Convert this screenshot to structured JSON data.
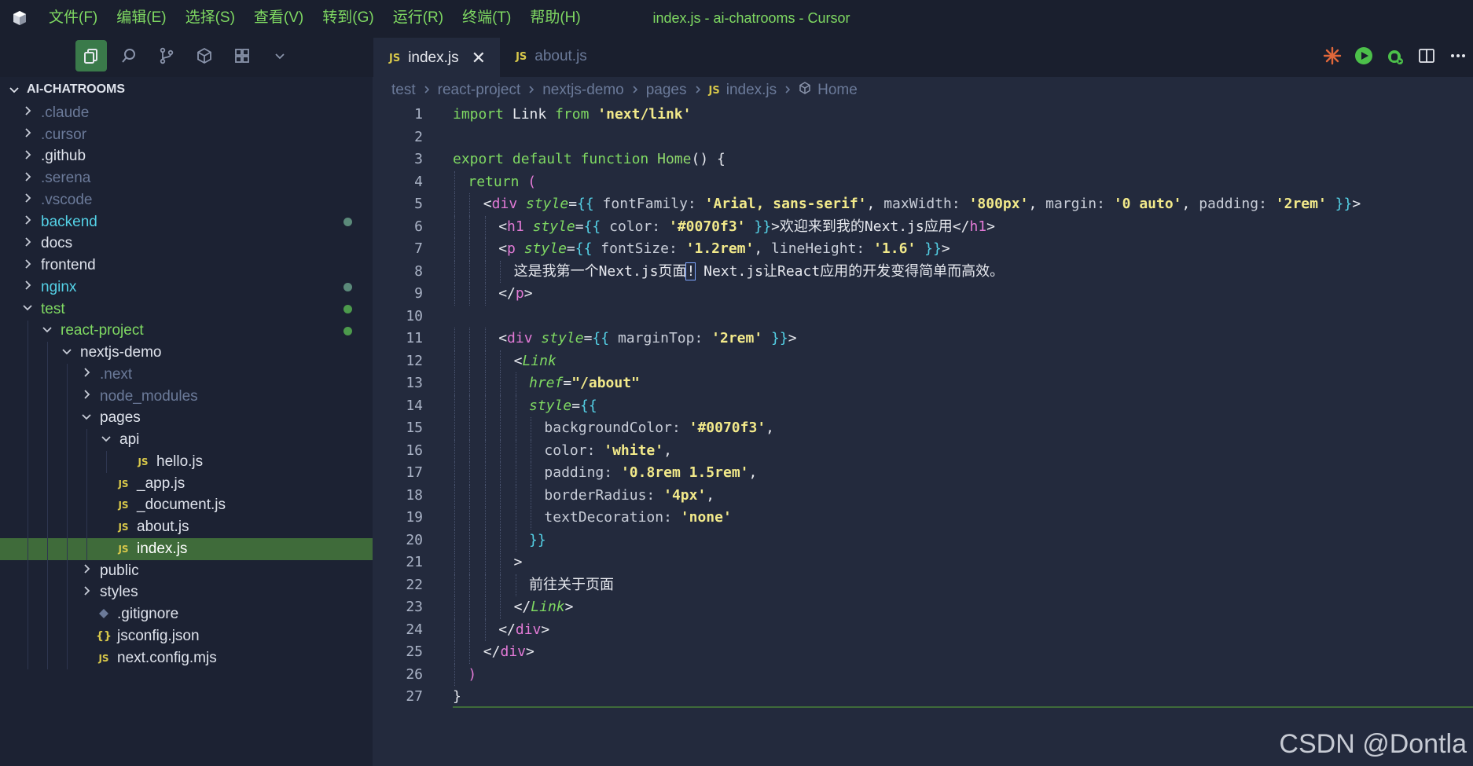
{
  "title_bar": {
    "logo_icon": "cursor-logo-icon",
    "menu": [
      "文件(F)",
      "编辑(E)",
      "选择(S)",
      "查看(V)",
      "转到(G)",
      "运行(R)",
      "终端(T)",
      "帮助(H)"
    ],
    "window_title": "index.js - ai-chatrooms - Cursor"
  },
  "sidebar_tools": [
    "files-icon",
    "search-icon",
    "source-control-icon",
    "extensions-icon",
    "layout-grid-icon",
    "chevron-down-icon"
  ],
  "tabs": [
    {
      "badge": "JS",
      "label": "index.js",
      "active": true,
      "close": "✕"
    },
    {
      "badge": "JS",
      "label": "about.js",
      "active": false
    }
  ],
  "right_tools": [
    "sparkle-icon",
    "run-icon",
    "debug-icon",
    "split-editor-icon",
    "more-icon"
  ],
  "explorer": {
    "title": "AI-CHATROOMS",
    "items": [
      {
        "label": ".claude",
        "depth": 0,
        "type": "folder",
        "open": false,
        "color": "#6b7a99"
      },
      {
        "label": ".cursor",
        "depth": 0,
        "type": "folder",
        "open": false,
        "color": "#6b7a99"
      },
      {
        "label": ".github",
        "depth": 0,
        "type": "folder",
        "open": false,
        "color": "#dfe3ec"
      },
      {
        "label": ".serena",
        "depth": 0,
        "type": "folder",
        "open": false,
        "color": "#6b7a99"
      },
      {
        "label": ".vscode",
        "depth": 0,
        "type": "folder",
        "open": false,
        "color": "#6b7a99"
      },
      {
        "label": "backend",
        "depth": 0,
        "type": "folder",
        "open": false,
        "color": "#54d1e6",
        "dot": "#5b8a7a"
      },
      {
        "label": "docs",
        "depth": 0,
        "type": "folder",
        "open": false,
        "color": "#dfe3ec"
      },
      {
        "label": "frontend",
        "depth": 0,
        "type": "folder",
        "open": false,
        "color": "#dfe3ec"
      },
      {
        "label": "nginx",
        "depth": 0,
        "type": "folder",
        "open": false,
        "color": "#54d1e6",
        "dot": "#5b8a7a"
      },
      {
        "label": "test",
        "depth": 0,
        "type": "folder",
        "open": true,
        "color": "#7fd962",
        "dot": "#4c9a4c"
      },
      {
        "label": "react-project",
        "depth": 1,
        "type": "folder",
        "open": true,
        "color": "#7fd962",
        "dot": "#4c9a4c"
      },
      {
        "label": "nextjs-demo",
        "depth": 2,
        "type": "folder",
        "open": true,
        "color": "#dfe3ec"
      },
      {
        "label": ".next",
        "depth": 3,
        "type": "folder",
        "open": false,
        "color": "#6b7a99"
      },
      {
        "label": "node_modules",
        "depth": 3,
        "type": "folder",
        "open": false,
        "color": "#6b7a99"
      },
      {
        "label": "pages",
        "depth": 3,
        "type": "folder",
        "open": true,
        "color": "#dfe3ec"
      },
      {
        "label": "api",
        "depth": 4,
        "type": "folder",
        "open": true,
        "color": "#dfe3ec"
      },
      {
        "label": "hello.js",
        "depth": 5,
        "type": "js",
        "color": "#dfe3ec"
      },
      {
        "label": "_app.js",
        "depth": 4,
        "type": "js",
        "color": "#dfe3ec"
      },
      {
        "label": "_document.js",
        "depth": 4,
        "type": "js",
        "color": "#dfe3ec"
      },
      {
        "label": "about.js",
        "depth": 4,
        "type": "js",
        "color": "#dfe3ec"
      },
      {
        "label": "index.js",
        "depth": 4,
        "type": "js",
        "color": "#ffffff",
        "selected": true
      },
      {
        "label": "public",
        "depth": 3,
        "type": "folder",
        "open": false,
        "color": "#dfe3ec"
      },
      {
        "label": "styles",
        "depth": 3,
        "type": "folder",
        "open": false,
        "color": "#dfe3ec"
      },
      {
        "label": ".gitignore",
        "depth": 3,
        "type": "git",
        "color": "#dfe3ec"
      },
      {
        "label": "jsconfig.json",
        "depth": 3,
        "type": "json",
        "color": "#dfe3ec"
      },
      {
        "label": "next.config.mjs",
        "depth": 3,
        "type": "js",
        "color": "#dfe3ec"
      }
    ]
  },
  "breadcrumb": {
    "parts": [
      "test",
      "react-project",
      "nextjs-demo",
      "pages"
    ],
    "file_badge": "JS",
    "file": "index.js",
    "symbol_icon": "cube-icon",
    "symbol": "Home"
  },
  "code_lines": [
    {
      "n": "1",
      "indent": 0,
      "tokens": [
        [
          "kw",
          "import"
        ],
        [
          "p",
          " Link "
        ],
        [
          "kw",
          "from"
        ],
        [
          "p",
          " "
        ],
        [
          "str",
          "'next/link'"
        ]
      ]
    },
    {
      "n": "2",
      "indent": 0,
      "tokens": []
    },
    {
      "n": "3",
      "indent": 0,
      "tokens": [
        [
          "kw",
          "export"
        ],
        [
          "p",
          " "
        ],
        [
          "kw",
          "default"
        ],
        [
          "p",
          " "
        ],
        [
          "kw",
          "function"
        ],
        [
          "p",
          " "
        ],
        [
          "fn",
          "Home"
        ],
        [
          "p",
          "() {"
        ]
      ]
    },
    {
      "n": "4",
      "indent": 1,
      "tokens": [
        [
          "kw",
          "return"
        ],
        [
          "p",
          " "
        ],
        [
          "tag",
          "("
        ]
      ]
    },
    {
      "n": "5",
      "indent": 2,
      "tokens": [
        [
          "p",
          "<"
        ],
        [
          "tag",
          "div"
        ],
        [
          "p",
          " "
        ],
        [
          "attr",
          "style"
        ],
        [
          "p",
          "="
        ],
        [
          "br",
          "{{"
        ],
        [
          "prop",
          " fontFamily: "
        ],
        [
          "str",
          "'Arial, sans-serif'"
        ],
        [
          "p",
          ", "
        ],
        [
          "prop",
          "maxWidth: "
        ],
        [
          "str",
          "'800px'"
        ],
        [
          "p",
          ", "
        ],
        [
          "prop",
          "margin: "
        ],
        [
          "str",
          "'0 auto'"
        ],
        [
          "p",
          ", "
        ],
        [
          "prop",
          "padding: "
        ],
        [
          "str",
          "'2rem'"
        ],
        [
          "p",
          " "
        ],
        [
          "br",
          "}}"
        ],
        [
          "p",
          ">"
        ]
      ]
    },
    {
      "n": "6",
      "indent": 3,
      "tokens": [
        [
          "p",
          "<"
        ],
        [
          "tag",
          "h1"
        ],
        [
          "p",
          " "
        ],
        [
          "attr",
          "style"
        ],
        [
          "p",
          "="
        ],
        [
          "br",
          "{{"
        ],
        [
          "prop",
          " color: "
        ],
        [
          "str",
          "'#0070f3'"
        ],
        [
          "p",
          " "
        ],
        [
          "br",
          "}}"
        ],
        [
          "p",
          ">"
        ],
        [
          "cn",
          "欢迎来到我的"
        ],
        [
          "p",
          "Next.js"
        ],
        [
          "cn",
          "应用"
        ],
        [
          "p",
          "</"
        ],
        [
          "tag",
          "h1"
        ],
        [
          "p",
          ">"
        ]
      ]
    },
    {
      "n": "7",
      "indent": 3,
      "tokens": [
        [
          "p",
          "<"
        ],
        [
          "tag",
          "p"
        ],
        [
          "p",
          " "
        ],
        [
          "attr",
          "style"
        ],
        [
          "p",
          "="
        ],
        [
          "br",
          "{{"
        ],
        [
          "prop",
          " fontSize: "
        ],
        [
          "str",
          "'1.2rem'"
        ],
        [
          "p",
          ", "
        ],
        [
          "prop",
          "lineHeight: "
        ],
        [
          "str",
          "'1.6'"
        ],
        [
          "p",
          " "
        ],
        [
          "br",
          "}}"
        ],
        [
          "p",
          ">"
        ]
      ]
    },
    {
      "n": "8",
      "indent": 4,
      "tokens": [
        [
          "cn",
          "这是我第一个"
        ],
        [
          "p",
          "Next.js"
        ],
        [
          "cn",
          "页面"
        ],
        [
          "cursor",
          "!"
        ],
        [
          "p",
          " Next.js"
        ],
        [
          "cn",
          "让"
        ],
        [
          "p",
          "React"
        ],
        [
          "cn",
          "应用的开发变得简单而高效。"
        ]
      ]
    },
    {
      "n": "9",
      "indent": 3,
      "tokens": [
        [
          "p",
          "</"
        ],
        [
          "tag",
          "p"
        ],
        [
          "p",
          ">"
        ]
      ]
    },
    {
      "n": "10",
      "indent": 0,
      "tokens": []
    },
    {
      "n": "11",
      "indent": 3,
      "tokens": [
        [
          "p",
          "<"
        ],
        [
          "tag",
          "div"
        ],
        [
          "p",
          " "
        ],
        [
          "attr",
          "style"
        ],
        [
          "p",
          "="
        ],
        [
          "br",
          "{{"
        ],
        [
          "prop",
          " marginTop: "
        ],
        [
          "str",
          "'2rem'"
        ],
        [
          "p",
          " "
        ],
        [
          "br",
          "}}"
        ],
        [
          "p",
          ">"
        ]
      ]
    },
    {
      "n": "12",
      "indent": 4,
      "tokens": [
        [
          "p",
          "<"
        ],
        [
          "attr",
          "Link"
        ]
      ]
    },
    {
      "n": "13",
      "indent": 5,
      "tokens": [
        [
          "attr",
          "href"
        ],
        [
          "p",
          "="
        ],
        [
          "str",
          "\"/about\""
        ]
      ]
    },
    {
      "n": "14",
      "indent": 5,
      "tokens": [
        [
          "attr",
          "style"
        ],
        [
          "p",
          "="
        ],
        [
          "br",
          "{{"
        ]
      ]
    },
    {
      "n": "15",
      "indent": 6,
      "tokens": [
        [
          "prop",
          "backgroundColor: "
        ],
        [
          "str",
          "'#0070f3'"
        ],
        [
          "p",
          ","
        ]
      ]
    },
    {
      "n": "16",
      "indent": 6,
      "tokens": [
        [
          "prop",
          "color: "
        ],
        [
          "str",
          "'white'"
        ],
        [
          "p",
          ","
        ]
      ]
    },
    {
      "n": "17",
      "indent": 6,
      "tokens": [
        [
          "prop",
          "padding: "
        ],
        [
          "str",
          "'0.8rem 1.5rem'"
        ],
        [
          "p",
          ","
        ]
      ]
    },
    {
      "n": "18",
      "indent": 6,
      "tokens": [
        [
          "prop",
          "borderRadius: "
        ],
        [
          "str",
          "'4px'"
        ],
        [
          "p",
          ","
        ]
      ]
    },
    {
      "n": "19",
      "indent": 6,
      "tokens": [
        [
          "prop",
          "textDecoration: "
        ],
        [
          "str",
          "'none'"
        ]
      ]
    },
    {
      "n": "20",
      "indent": 5,
      "tokens": [
        [
          "br",
          "}}"
        ]
      ]
    },
    {
      "n": "21",
      "indent": 4,
      "tokens": [
        [
          "p",
          ">"
        ]
      ]
    },
    {
      "n": "22",
      "indent": 5,
      "tokens": [
        [
          "cn",
          "前往关于页面"
        ]
      ]
    },
    {
      "n": "23",
      "indent": 4,
      "tokens": [
        [
          "p",
          "</"
        ],
        [
          "attr",
          "Link"
        ],
        [
          "p",
          ">"
        ]
      ]
    },
    {
      "n": "24",
      "indent": 3,
      "tokens": [
        [
          "p",
          "</"
        ],
        [
          "tag",
          "div"
        ],
        [
          "p",
          ">"
        ]
      ]
    },
    {
      "n": "25",
      "indent": 2,
      "tokens": [
        [
          "p",
          "</"
        ],
        [
          "tag",
          "div"
        ],
        [
          "p",
          ">"
        ]
      ]
    },
    {
      "n": "26",
      "indent": 1,
      "tokens": [
        [
          "tag",
          ")"
        ]
      ]
    },
    {
      "n": "27",
      "indent": 0,
      "tokens": [
        [
          "p",
          "}"
        ]
      ]
    }
  ],
  "watermark": "CSDN @Dontla"
}
